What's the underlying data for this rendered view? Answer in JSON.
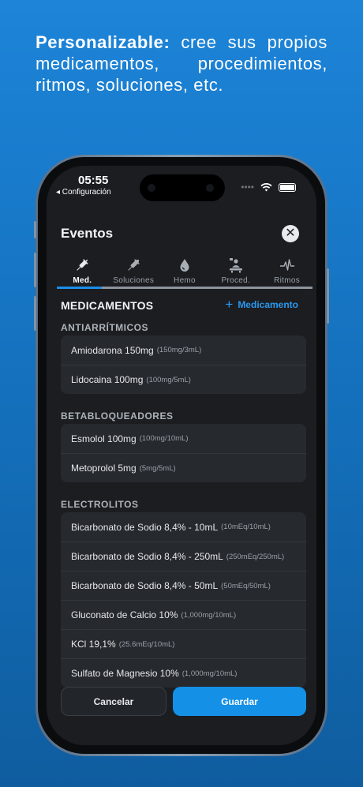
{
  "headline": {
    "bold": "Personalizable:",
    "rest": " cree sus propios medicamentos, procedimientos, ritmos, soluciones, etc."
  },
  "status_bar": {
    "time": "05:55",
    "back_label": "◂ Configuración"
  },
  "sheet": {
    "title": "Eventos",
    "close_icon": "✕"
  },
  "tabs": [
    {
      "label": "Med.",
      "icon": "syringe-icon",
      "active": true
    },
    {
      "label": "Soluciones",
      "icon": "iv-syringe-icon",
      "active": false
    },
    {
      "label": "Hemo",
      "icon": "blood-drop-icon",
      "active": false
    },
    {
      "label": "Proced.",
      "icon": "procedure-icon",
      "active": false
    },
    {
      "label": "Ritmos",
      "icon": "heartbeat-icon",
      "active": false
    }
  ],
  "section": {
    "title": "MEDICAMENTOS",
    "add_plus": "+",
    "add_label": "Medicamento"
  },
  "groups": [
    {
      "label": "ANTIARRÍTMICOS",
      "items": [
        {
          "name": "Amiodarona 150mg",
          "dose": "(150mg/3mL)"
        },
        {
          "name": "Lidocaina 100mg",
          "dose": "(100mg/5mL)"
        }
      ]
    },
    {
      "label": "BETABLOQUEADORES",
      "items": [
        {
          "name": "Esmolol 100mg",
          "dose": "(100mg/10mL)"
        },
        {
          "name": "Metoprolol 5mg",
          "dose": "(5mg/5mL)"
        }
      ]
    },
    {
      "label": "ELECTROLITOS",
      "items": [
        {
          "name": "Bicarbonato de Sodio 8,4% - 10mL",
          "dose": "(10mEq/10mL)"
        },
        {
          "name": "Bicarbonato de Sodio 8,4% - 250mL",
          "dose": "(250mEq/250mL)"
        },
        {
          "name": "Bicarbonato de Sodio 8,4% - 50mL",
          "dose": "(50mEq/50mL)"
        },
        {
          "name": "Gluconato de Calcio 10%",
          "dose": "(1,000mg/10mL)"
        },
        {
          "name": "KCl 19,1%",
          "dose": "(25.6mEq/10mL)"
        },
        {
          "name": "Sulfato de Magnesio 10%",
          "dose": "(1,000mg/10mL)"
        }
      ]
    }
  ],
  "actions": {
    "cancel": "Cancelar",
    "save": "Guardar"
  },
  "colors": {
    "accent": "#1490e6",
    "background_top": "#1d84d8",
    "sheet": "#1b1d21",
    "card": "#26292e"
  }
}
